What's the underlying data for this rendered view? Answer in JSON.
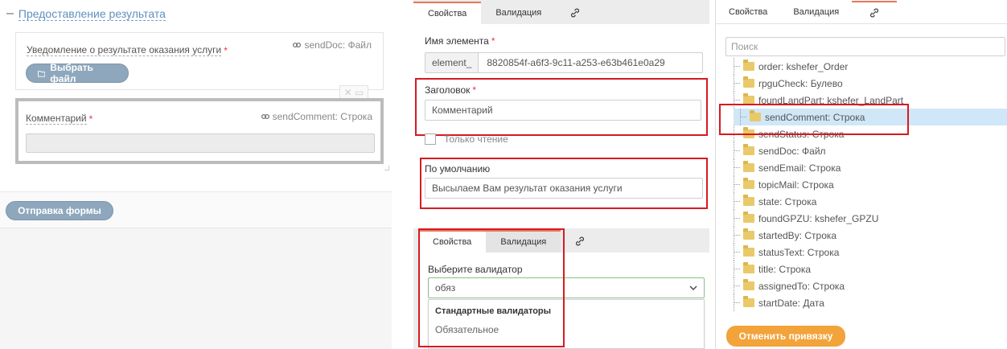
{
  "left": {
    "section_title": "Предоставление результата",
    "section_dash": "–",
    "notification_label": "Уведомление о результате оказания услуги",
    "notification_bind": "sendDoc: Файл",
    "choose_file_label": "Выбрать файл",
    "comment_label": "Комментарий",
    "comment_bind": "sendComment: Строка",
    "submit_label": "Отправка формы",
    "required_mark": "*"
  },
  "middle": {
    "tabs": [
      {
        "label": "Свойства"
      },
      {
        "label": "Валидация"
      }
    ],
    "element_name_label": "Имя элемента",
    "element_prefix": "element_",
    "element_value": "8820854f-a6f3-9c11-a253-e63b461e0a29",
    "header_label": "Заголовок",
    "header_value": "Комментарий",
    "readonly_label": "Только чтение",
    "default_label": "По умолчанию",
    "default_value": "Высылаем Вам результат оказания услуги",
    "validator_tabs": [
      {
        "label": "Свойства"
      },
      {
        "label": "Валидация"
      }
    ],
    "validator_label": "Выберите валидатор",
    "validator_input": "обяз",
    "dropdown_group": "Стандартные валидаторы",
    "dropdown_option": "Обязательное",
    "required_mark": "*"
  },
  "right": {
    "tabs": [
      {
        "label": "Свойства"
      },
      {
        "label": "Валидация"
      }
    ],
    "search_placeholder": "Поиск",
    "tree": [
      {
        "label": "order: kshefer_Order"
      },
      {
        "label": "rpguCheck: Булево"
      },
      {
        "label": "foundLandPart: kshefer_LandPart"
      },
      {
        "label": "sendComment: Строка",
        "selected": true
      },
      {
        "label": "sendStatus: Строка"
      },
      {
        "label": "sendDoc: Файл"
      },
      {
        "label": "sendEmail: Строка"
      },
      {
        "label": "topicMail: Строка"
      },
      {
        "label": "state: Строка"
      },
      {
        "label": "foundGPZU: kshefer_GPZU"
      },
      {
        "label": "startedBy: Строка"
      },
      {
        "label": "statusText: Строка"
      },
      {
        "label": "title: Строка"
      },
      {
        "label": "assignedTo: Строка"
      },
      {
        "label": "startDate: Дата"
      }
    ],
    "unbind_label": "Отменить привязку"
  },
  "colors": {
    "accent_red": "#d71a21",
    "tab_accent": "#e8775a",
    "orange_button": "#f2a33a",
    "selected_row": "#cfe7f7",
    "link_blue": "#5f8fc0"
  }
}
